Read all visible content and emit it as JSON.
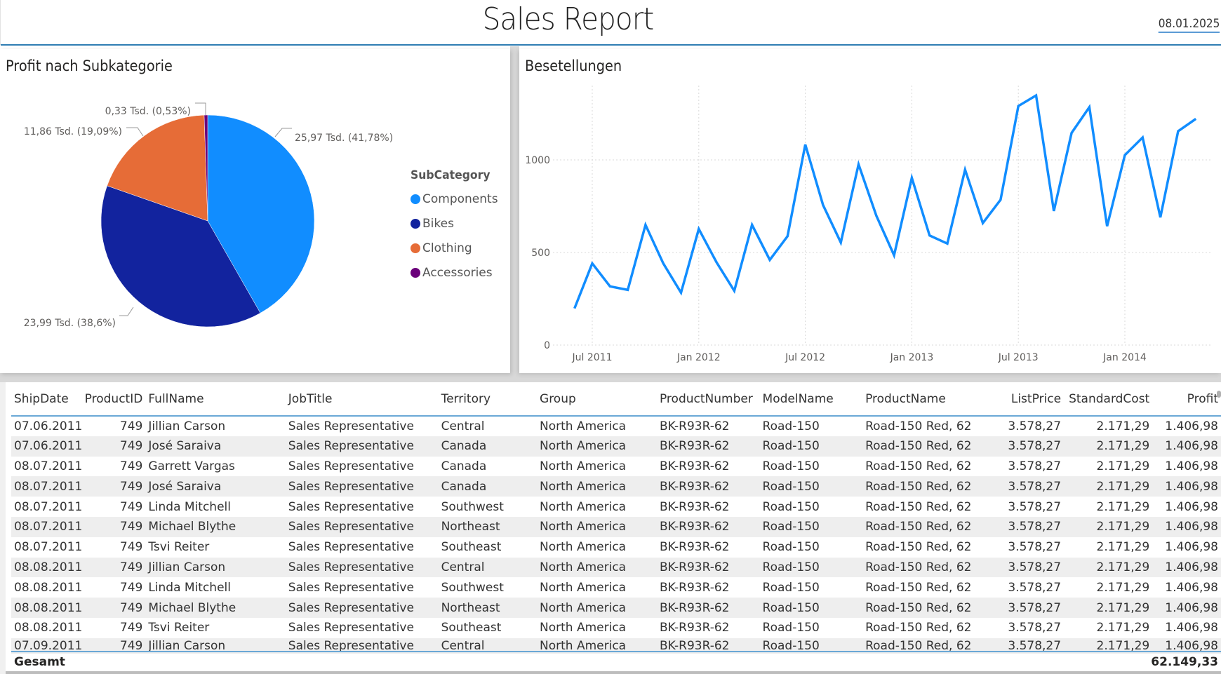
{
  "header": {
    "title": "Sales Report",
    "date": "08.01.2025"
  },
  "pie_panel": {
    "title": "Profit nach Subkategorie",
    "legend_title": "SubCategory"
  },
  "line_panel": {
    "title": "Besetellungen"
  },
  "chart_data": [
    {
      "type": "pie",
      "title": "Profit nach Subkategorie",
      "legend_title": "SubCategory",
      "legend_position": "right",
      "slices": [
        {
          "label": "Components",
          "value": 25.97,
          "percent": 41.78,
          "data_label": "25,97 Tsd. (41,78%)",
          "color": "#118dff"
        },
        {
          "label": "Bikes",
          "value": 23.99,
          "percent": 38.6,
          "data_label": "23,99 Tsd. (38,6%)",
          "color": "#12239e"
        },
        {
          "label": "Clothing",
          "value": 11.86,
          "percent": 19.09,
          "data_label": "11,86 Tsd. (19,09%)",
          "color": "#e66c37"
        },
        {
          "label": "Accessories",
          "value": 0.33,
          "percent": 0.53,
          "data_label": "0,33 Tsd. (0,53%)",
          "color": "#6b007b"
        }
      ],
      "value_unit": "Tsd."
    },
    {
      "type": "line",
      "title": "Besetellungen",
      "xlabel": "",
      "ylabel": "",
      "ylim": [
        0,
        1400
      ],
      "yticks": [
        0,
        500,
        1000
      ],
      "x_ticks": [
        "Jul 2011",
        "Jan 2012",
        "Jul 2012",
        "Jan 2013",
        "Jul 2013",
        "Jan 2014"
      ],
      "grid": true,
      "series": [
        {
          "name": "Bestellungen",
          "color": "#118dff",
          "x": [
            "2011-06",
            "2011-07",
            "2011-08",
            "2011-09",
            "2011-10",
            "2011-11",
            "2011-12",
            "2012-01",
            "2012-02",
            "2012-03",
            "2012-04",
            "2012-05",
            "2012-06",
            "2012-07",
            "2012-08",
            "2012-09",
            "2012-10",
            "2012-11",
            "2012-12",
            "2013-01",
            "2013-02",
            "2013-03",
            "2013-04",
            "2013-05",
            "2013-06",
            "2013-07",
            "2013-08",
            "2013-09",
            "2013-10",
            "2013-11",
            "2013-12",
            "2014-01",
            "2014-02",
            "2014-03",
            "2014-04",
            "2014-05"
          ],
          "values": [
            198,
            441,
            317,
            298,
            649,
            441,
            283,
            627,
            447,
            293,
            649,
            460,
            588,
            1083,
            756,
            554,
            976,
            699,
            485,
            903,
            592,
            548,
            947,
            659,
            785,
            1291,
            1348,
            724,
            1146,
            1285,
            642,
            1026,
            1121,
            690,
            1155,
            1222
          ]
        }
      ]
    }
  ],
  "table": {
    "columns": [
      {
        "label": "ShipDate",
        "align": "left"
      },
      {
        "label": "ProductID",
        "align": "right"
      },
      {
        "label": "FullName",
        "align": "left"
      },
      {
        "label": "JobTitle",
        "align": "left"
      },
      {
        "label": "Territory",
        "align": "left"
      },
      {
        "label": "Group",
        "align": "left"
      },
      {
        "label": "ProductNumber",
        "align": "left"
      },
      {
        "label": "ModelName",
        "align": "left"
      },
      {
        "label": "ProductName",
        "align": "left"
      },
      {
        "label": "ListPrice",
        "align": "right"
      },
      {
        "label": "StandardCost",
        "align": "right"
      },
      {
        "label": "Profit",
        "align": "right"
      }
    ],
    "rows": [
      [
        "07.06.2011",
        "749",
        "Jillian Carson",
        "Sales Representative",
        "Central",
        "North America",
        "BK-R93R-62",
        "Road-150",
        "Road-150 Red, 62",
        "3.578,27",
        "2.171,29",
        "1.406,98"
      ],
      [
        "07.06.2011",
        "749",
        "José Saraiva",
        "Sales Representative",
        "Canada",
        "North America",
        "BK-R93R-62",
        "Road-150",
        "Road-150 Red, 62",
        "3.578,27",
        "2.171,29",
        "1.406,98"
      ],
      [
        "08.07.2011",
        "749",
        "Garrett Vargas",
        "Sales Representative",
        "Canada",
        "North America",
        "BK-R93R-62",
        "Road-150",
        "Road-150 Red, 62",
        "3.578,27",
        "2.171,29",
        "1.406,98"
      ],
      [
        "08.07.2011",
        "749",
        "José Saraiva",
        "Sales Representative",
        "Canada",
        "North America",
        "BK-R93R-62",
        "Road-150",
        "Road-150 Red, 62",
        "3.578,27",
        "2.171,29",
        "1.406,98"
      ],
      [
        "08.07.2011",
        "749",
        "Linda Mitchell",
        "Sales Representative",
        "Southwest",
        "North America",
        "BK-R93R-62",
        "Road-150",
        "Road-150 Red, 62",
        "3.578,27",
        "2.171,29",
        "1.406,98"
      ],
      [
        "08.07.2011",
        "749",
        "Michael Blythe",
        "Sales Representative",
        "Northeast",
        "North America",
        "BK-R93R-62",
        "Road-150",
        "Road-150 Red, 62",
        "3.578,27",
        "2.171,29",
        "1.406,98"
      ],
      [
        "08.07.2011",
        "749",
        "Tsvi Reiter",
        "Sales Representative",
        "Southeast",
        "North America",
        "BK-R93R-62",
        "Road-150",
        "Road-150 Red, 62",
        "3.578,27",
        "2.171,29",
        "1.406,98"
      ],
      [
        "08.08.2011",
        "749",
        "Jillian Carson",
        "Sales Representative",
        "Central",
        "North America",
        "BK-R93R-62",
        "Road-150",
        "Road-150 Red, 62",
        "3.578,27",
        "2.171,29",
        "1.406,98"
      ],
      [
        "08.08.2011",
        "749",
        "Linda Mitchell",
        "Sales Representative",
        "Southwest",
        "North America",
        "BK-R93R-62",
        "Road-150",
        "Road-150 Red, 62",
        "3.578,27",
        "2.171,29",
        "1.406,98"
      ],
      [
        "08.08.2011",
        "749",
        "Michael Blythe",
        "Sales Representative",
        "Northeast",
        "North America",
        "BK-R93R-62",
        "Road-150",
        "Road-150 Red, 62",
        "3.578,27",
        "2.171,29",
        "1.406,98"
      ],
      [
        "08.08.2011",
        "749",
        "Tsvi Reiter",
        "Sales Representative",
        "Southeast",
        "North America",
        "BK-R93R-62",
        "Road-150",
        "Road-150 Red, 62",
        "3.578,27",
        "2.171,29",
        "1.406,98"
      ],
      [
        "07.09.2011",
        "749",
        "Jillian Carson",
        "Sales Representative",
        "Central",
        "North America",
        "BK-R93R-62",
        "Road-150",
        "Road-150 Red, 62",
        "3.578,27",
        "2.171,29",
        "1.406,98"
      ]
    ],
    "totals_label": "Gesamt",
    "totals_profit": "62.149,33"
  }
}
